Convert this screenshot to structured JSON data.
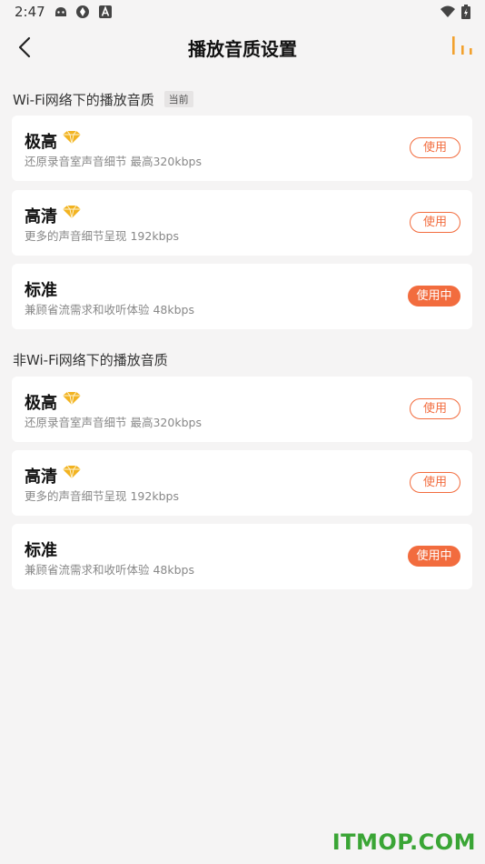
{
  "status_bar": {
    "time": "2:47"
  },
  "header": {
    "title": "播放音质设置"
  },
  "sections": [
    {
      "title": "Wi-Fi网络下的播放音质",
      "badge": "当前",
      "options": [
        {
          "name": "极高",
          "desc": "还原录音室声音细节 最高320kbps",
          "button": "使用",
          "active": false,
          "vip": true
        },
        {
          "name": "高清",
          "desc": "更多的声音细节呈现 192kbps",
          "button": "使用",
          "active": false,
          "vip": true
        },
        {
          "name": "标准",
          "desc": "兼顾省流需求和收听体验 48kbps",
          "button": "使用中",
          "active": true,
          "vip": false
        }
      ]
    },
    {
      "title": "非Wi-Fi网络下的播放音质",
      "options": [
        {
          "name": "极高",
          "desc": "还原录音室声音细节 最高320kbps",
          "button": "使用",
          "active": false,
          "vip": true
        },
        {
          "name": "高清",
          "desc": "更多的声音细节呈现 192kbps",
          "button": "使用",
          "active": false,
          "vip": true
        },
        {
          "name": "标准",
          "desc": "兼顾省流需求和收听体验 48kbps",
          "button": "使用中",
          "active": true,
          "vip": false
        }
      ]
    }
  ],
  "watermark": "ITMOP.COM",
  "colors": {
    "accent": "#f26c3e",
    "gold": "#f2b321",
    "watermark": "#3aa535"
  }
}
